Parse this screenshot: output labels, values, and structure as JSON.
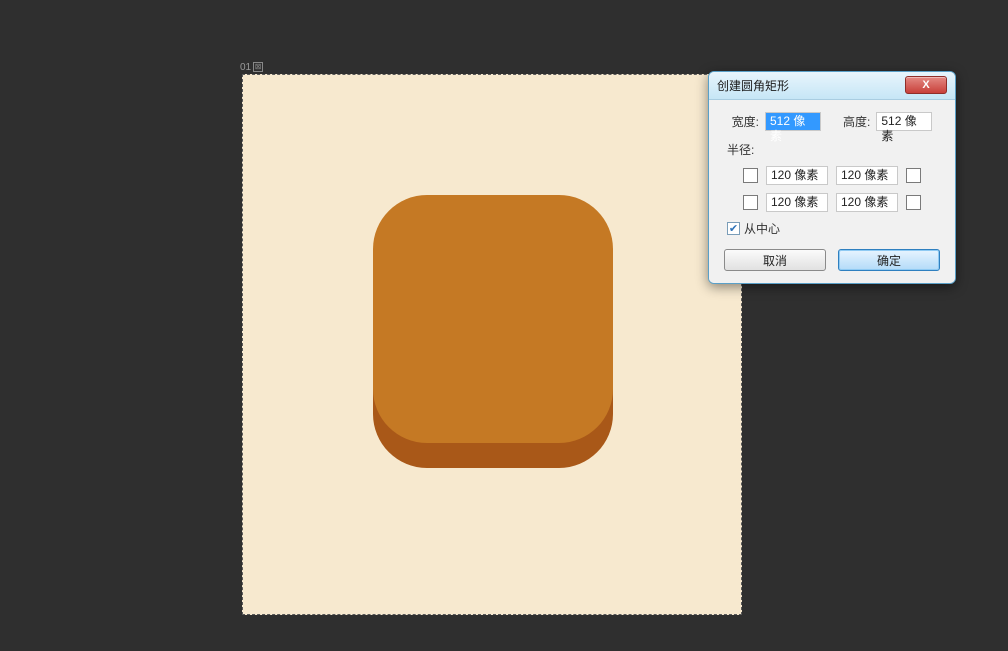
{
  "canvas": {
    "tab_label": "01",
    "shape_color_front": "#c57924",
    "shape_color_back": "#a95818",
    "bg_color": "#f7e9cf"
  },
  "dialog": {
    "title": "创建圆角矩形",
    "close_label": "X",
    "width_label": "宽度:",
    "width_value": "512 像素",
    "height_label": "高度:",
    "height_value": "512 像素",
    "radius_label": "半径:",
    "r_tl": "120 像素",
    "r_tr": "120 像素",
    "r_bl": "120 像素",
    "r_br": "120 像素",
    "from_center_label": "从中心",
    "from_center_checked": true,
    "cancel_label": "取消",
    "ok_label": "确定"
  }
}
